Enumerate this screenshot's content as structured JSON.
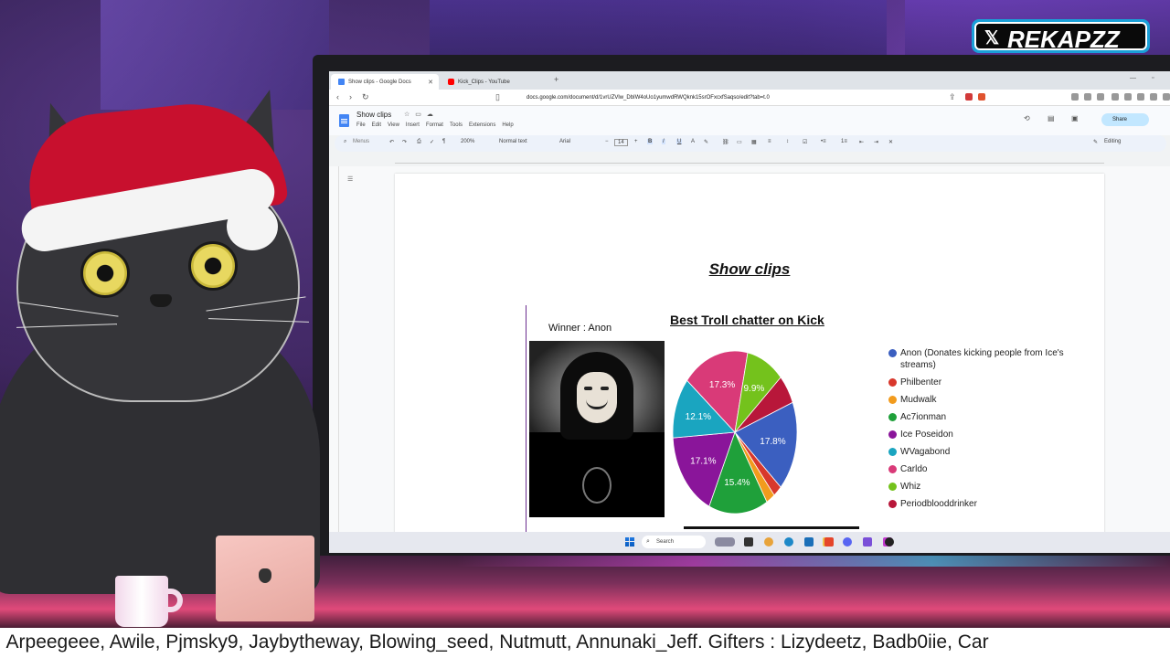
{
  "browser": {
    "tabs": [
      {
        "label": "Show clips - Google Docs",
        "favicon_color": "#4285f4",
        "active": true
      },
      {
        "label": "Kick_Clips - YouTube",
        "favicon_color": "#ff0000",
        "active": false
      }
    ],
    "url": "docs.google.com/document/d/1vrUZVlw_DbIW4oUo1yumwdRWQknk15srOFxcxfSaqso/edit?tab=t.0"
  },
  "docs": {
    "title": "Show clips",
    "menu": [
      "File",
      "Edit",
      "View",
      "Insert",
      "Format",
      "Tools",
      "Extensions",
      "Help"
    ],
    "share_label": "Share",
    "toolbar": {
      "search": "Menus",
      "zoom": "200%",
      "style": "Normal text",
      "font": "Arial",
      "font_size": "14",
      "mode": "Editing"
    }
  },
  "document": {
    "heading": "Show clips",
    "winner_label": "Winner : Anon",
    "chart_title": "Best Troll chatter on Kick"
  },
  "chart_data": {
    "type": "pie",
    "title": "Best Troll chatter on Kick",
    "legend_position": "right",
    "series": [
      {
        "name": "Anon (Donates kicking people from Ice's streams)",
        "value": 17.8,
        "color": "#3b5fc0"
      },
      {
        "name": "Philbenter",
        "value": 2.3,
        "color": "#d8382c"
      },
      {
        "name": "Mudwalk",
        "value": 2.3,
        "color": "#f29b1d"
      },
      {
        "name": "Ac7ionman",
        "value": 15.4,
        "color": "#1fa03a"
      },
      {
        "name": "Ice Poseidon",
        "value": 17.1,
        "color": "#8a159a"
      },
      {
        "name": "WVagabond",
        "value": 12.1,
        "color": "#1aa5c0"
      },
      {
        "name": "Carldo",
        "value": 17.3,
        "color": "#d93a78"
      },
      {
        "name": "Whiz",
        "value": 9.9,
        "color": "#74c21c"
      },
      {
        "name": "Periodblooddrinker",
        "value": 5.8,
        "color": "#b8173a"
      }
    ],
    "labels_shown": [
      "17.8%",
      "15.4%",
      "17.1%",
      "12.1%",
      "17.3%",
      "9.9%"
    ]
  },
  "taskbar": {
    "search_label": "Search"
  },
  "overlay": {
    "badge_text": "REKAPZZ",
    "ticker": ", Arpeegeee, Awile, Pjmsky9, Jaybytheway, Blowing_seed, Nutmutt, Annunaki_Jeff. Gifters : Lizydeetz, Badb0iie, Car"
  }
}
